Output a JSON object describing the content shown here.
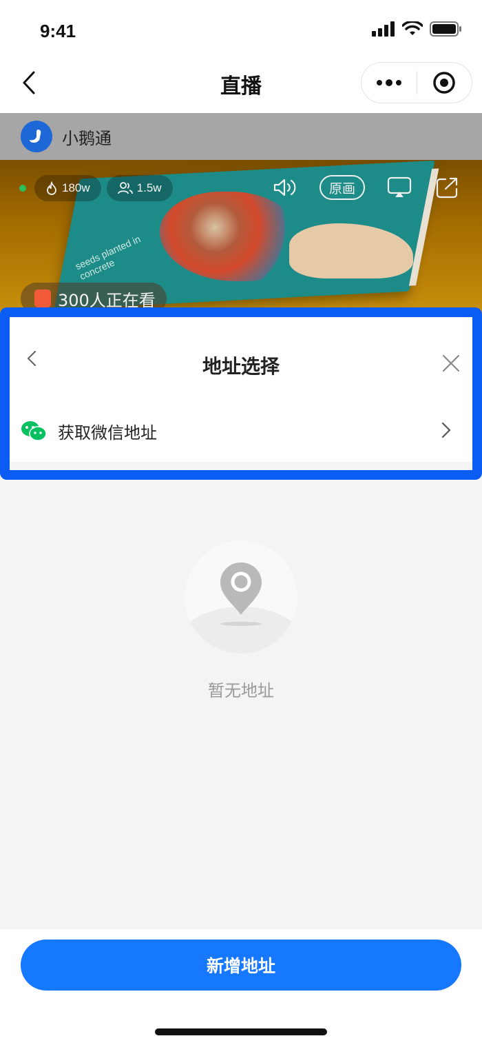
{
  "status_bar": {
    "time": "9:41"
  },
  "nav": {
    "title": "直播"
  },
  "shop": {
    "name": "小鹅通"
  },
  "video": {
    "heat": "180w",
    "fans": "1.5w",
    "quality_label": "原画",
    "viewers_text": "300人正在看",
    "book_text": "seeds planted in concrete"
  },
  "sheet": {
    "title": "地址选择",
    "wechat_label": "获取微信地址"
  },
  "empty": {
    "text": "暂无地址"
  },
  "bottom": {
    "add_label": "新增地址"
  },
  "colors": {
    "accent": "#1677ff",
    "highlight_frame": "#0a5cf5",
    "wechat_green": "#07c160"
  }
}
